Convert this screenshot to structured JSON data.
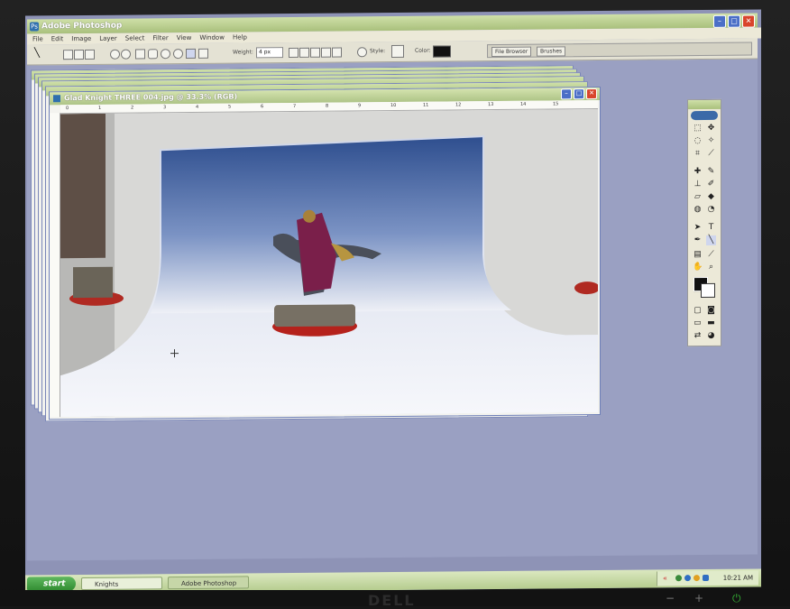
{
  "app": {
    "title": "Adobe Photoshop",
    "menu": [
      "File",
      "Edit",
      "Image",
      "Layer",
      "Select",
      "Filter",
      "View",
      "Window",
      "Help"
    ]
  },
  "options_bar": {
    "weight_label": "Weight:",
    "weight_value": "4 px",
    "style_label": "Style:",
    "color_label": "Color:",
    "palette_tabs": [
      "File Browser",
      "Brushes"
    ]
  },
  "document": {
    "title": "Glad Knight THREE 004.jpg @ 33.3% (RGB)",
    "ruler_ticks": [
      "0",
      "1",
      "2",
      "3",
      "4",
      "5",
      "6",
      "7",
      "8",
      "9",
      "10",
      "11",
      "12",
      "13",
      "14",
      "15"
    ]
  },
  "taskbar": {
    "start_label": "start",
    "tasks": [
      {
        "label": "Knights",
        "active": false
      },
      {
        "label": "Adobe Photoshop",
        "active": true
      }
    ],
    "clock": "10:21 AM"
  },
  "monitor": {
    "brand": "DELL"
  },
  "colors": {
    "title_bar": "#a9c07c",
    "desktop": "#8e93b6",
    "backdrop_blue": "#2f4f8f"
  }
}
